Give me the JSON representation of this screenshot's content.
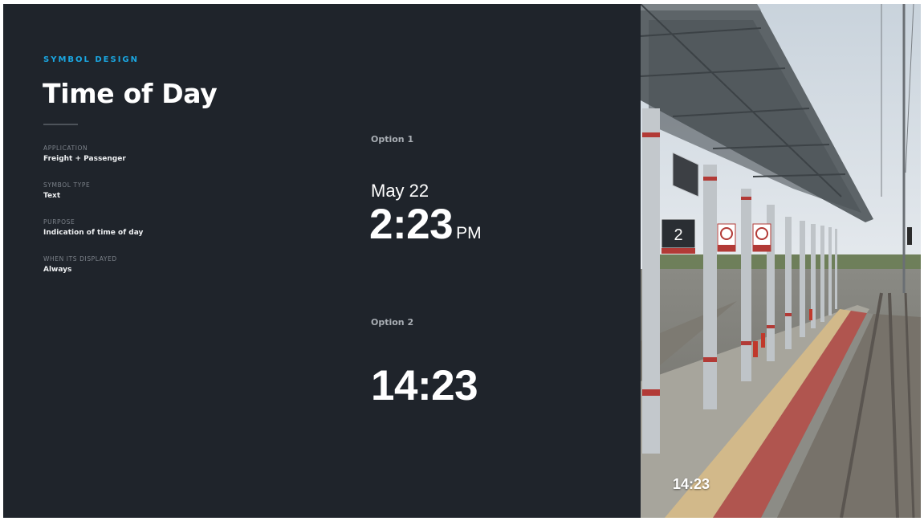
{
  "header": {
    "eyebrow": "SYMBOL DESIGN",
    "title": "Time of Day"
  },
  "meta": [
    {
      "label": "APPLICATION",
      "value": "Freight + Passenger"
    },
    {
      "label": "SYMBOL TYPE",
      "value": "Text"
    },
    {
      "label": "PURPOSE",
      "value": "Indication of time of day"
    },
    {
      "label": "WHEN ITS DISPLAYED",
      "value": "Always"
    }
  ],
  "options": {
    "option1": {
      "label": "Option 1",
      "date": "May 22",
      "time": "2:23",
      "ampm": "PM"
    },
    "option2": {
      "label": "Option 2",
      "time": "14:23"
    }
  },
  "photo": {
    "overlay_time": "14:23",
    "platform_sign": "2"
  },
  "colors": {
    "background": "#1f242b",
    "accent": "#1aa7e2",
    "text": "#ffffff"
  }
}
